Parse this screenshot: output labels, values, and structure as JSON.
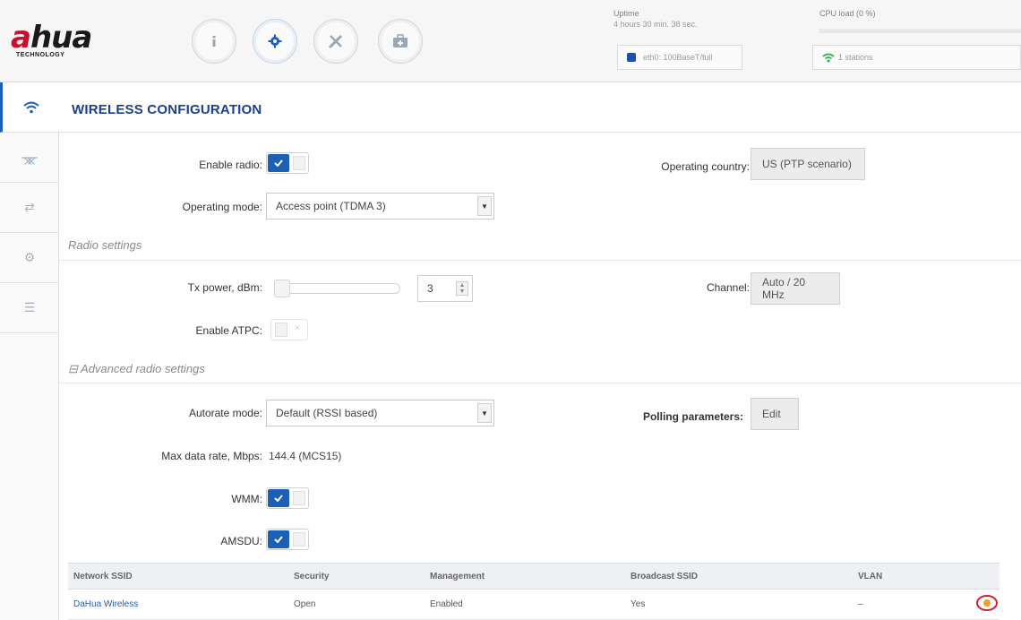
{
  "brand": {
    "logo_text_prefix": "a",
    "logo_text_rest": "hua",
    "logo_sub": "TECHNOLOGY",
    "accent": "#c8102e"
  },
  "top_nav": [
    {
      "name": "info",
      "icon": "info-icon"
    },
    {
      "name": "settings",
      "icon": "gear-icon",
      "active": true
    },
    {
      "name": "tools",
      "icon": "tools-icon"
    },
    {
      "name": "toolbox",
      "icon": "toolbox-icon"
    }
  ],
  "status": {
    "uptime_label": "Uptime",
    "uptime_value": "4 hours 30 min. 38 sec.",
    "cpu_label": "CPU load (0 %)",
    "cpu_percent": 0,
    "eth_text": "eth0: 100BaseT/full",
    "stations_text": "1 stations"
  },
  "sidebar": [
    {
      "icon": "wifi-icon",
      "active": true
    },
    {
      "icon": "network-tree-icon"
    },
    {
      "icon": "arrows-icon"
    },
    {
      "icon": "gears-icon"
    },
    {
      "icon": "sliders-icon"
    }
  ],
  "page": {
    "title": "WIRELESS CONFIGURATION"
  },
  "form": {
    "enable_radio_label": "Enable radio:",
    "operating_country_label": "Operating country:",
    "operating_country_value": "US (PTP scenario)",
    "operating_mode_label": "Operating mode:",
    "operating_mode_value": "Access point (TDMA 3)",
    "radio_settings_title": "Radio settings",
    "tx_power_label": "Tx power, dBm:",
    "tx_power_value": "3",
    "channel_label": "Channel:",
    "channel_value": "Auto / 20 MHz",
    "enable_atpc_label": "Enable ATPC:",
    "advanced_title": "⊟ Advanced radio settings",
    "autorate_label": "Autorate mode:",
    "autorate_value": "Default (RSSI based)",
    "polling_label": "Polling parameters:",
    "polling_button": "Edit",
    "max_rate_label": "Max data rate, Mbps:",
    "max_rate_value": "144.4 (MCS15)",
    "wmm_label": "WMM:",
    "amsdu_label": "AMSDU:"
  },
  "table": {
    "columns": [
      "Network SSID",
      "Security",
      "Management",
      "Broadcast SSID",
      "VLAN"
    ],
    "rows": [
      [
        "DaHua Wireless",
        "Open",
        "Enabled",
        "Yes",
        "–"
      ]
    ]
  }
}
